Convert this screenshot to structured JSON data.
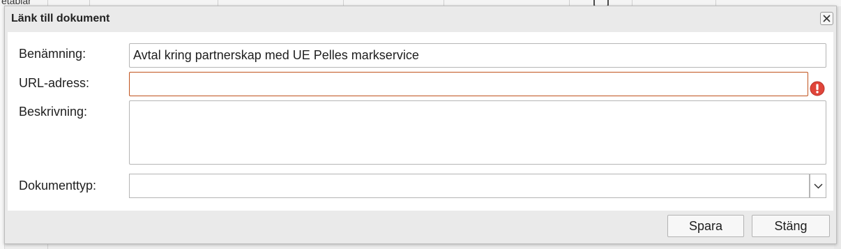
{
  "background": {
    "partial_text": "etablar"
  },
  "dialog": {
    "title": "Länk till dokument",
    "close_icon": "close-x-icon",
    "fields": {
      "name": {
        "label": "Benämning:",
        "value": "Avtal kring partnerskap med UE Pelles markservice"
      },
      "url": {
        "label": "URL-adress:",
        "value": "",
        "error_icon": "error-exclamation-icon"
      },
      "description": {
        "label": "Beskrivning:",
        "value": ""
      },
      "document_type": {
        "label": "Dokumenttyp:",
        "selected": "",
        "dropdown_icon": "chevron-down-icon"
      }
    },
    "buttons": {
      "save": "Spara",
      "close": "Stäng"
    }
  },
  "colors": {
    "error_border": "#c0521c",
    "error_icon": "#e0453a",
    "content_bg": "#ffffff",
    "dialog_bg": "#eaeaea"
  }
}
